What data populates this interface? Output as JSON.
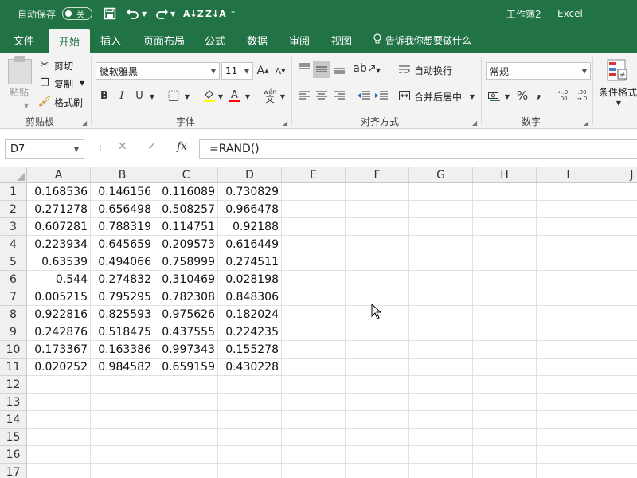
{
  "titlebar": {
    "autosave_label": "自动保存",
    "autosave_state": "关",
    "doc_title": "工作簿2",
    "separator": "-",
    "app_name": "Excel",
    "icons": [
      "save-icon",
      "undo-icon",
      "redo-icon",
      "sort-ascending-icon",
      "sort-descending-icon",
      "customize-quick-access-icon"
    ]
  },
  "tabs": [
    "文件",
    "开始",
    "插入",
    "页面布局",
    "公式",
    "数据",
    "审阅",
    "视图"
  ],
  "active_tab": "开始",
  "tell_me": "告诉我你想要做什么",
  "ribbon": {
    "clipboard": {
      "paste": "粘贴",
      "cut": "剪切",
      "copy": "复制",
      "format_painter": "格式刷",
      "group_label": "剪贴板"
    },
    "font": {
      "font_name": "微软雅黑",
      "font_size": "11",
      "bold": "B",
      "italic": "I",
      "underline": "U",
      "grow": "A",
      "shrink": "A",
      "phonetic_top": "wén",
      "phonetic_bottom": "文",
      "group_label": "字体",
      "fill_color": "#ffff00",
      "font_color": "#ff0000"
    },
    "alignment": {
      "wrap_text": "自动换行",
      "merge_center": "合并后居中",
      "group_label": "对齐方式"
    },
    "number": {
      "format": "常规",
      "percent": "%",
      "comma": ",",
      "group_label": "数字"
    },
    "styles": {
      "conditional_formatting": "条件格式"
    }
  },
  "formula_bar": {
    "name_box": "D7",
    "cancel": "✕",
    "enter": "✓",
    "function": "fx",
    "formula": "=RAND()"
  },
  "sheet": {
    "columns": [
      "A",
      "B",
      "C",
      "D",
      "E",
      "F",
      "G",
      "H",
      "I",
      "J"
    ],
    "row_numbers": [
      "1",
      "2",
      "3",
      "4",
      "5",
      "6",
      "7",
      "8",
      "9",
      "10",
      "11",
      "12",
      "13",
      "14",
      "15",
      "16",
      "17"
    ],
    "rows": [
      [
        "0.168536",
        "0.146156",
        "0.116089",
        "0.730829"
      ],
      [
        "0.271278",
        "0.656498",
        "0.508257",
        "0.966478"
      ],
      [
        "0.607281",
        "0.788319",
        "0.114751",
        "0.92188"
      ],
      [
        "0.223934",
        "0.645659",
        "0.209573",
        "0.616449"
      ],
      [
        "0.63539",
        "0.494066",
        "0.758999",
        "0.274511"
      ],
      [
        "0.544",
        "0.274832",
        "0.310469",
        "0.028198"
      ],
      [
        "0.005215",
        "0.795295",
        "0.782308",
        "0.848306"
      ],
      [
        "0.922816",
        "0.825593",
        "0.975626",
        "0.182024"
      ],
      [
        "0.242876",
        "0.518475",
        "0.437555",
        "0.224235"
      ],
      [
        "0.173367",
        "0.163386",
        "0.997343",
        "0.155278"
      ],
      [
        "0.020252",
        "0.984582",
        "0.659159",
        "0.430228"
      ]
    ]
  },
  "colors": {
    "brand": "#217346",
    "ribbon_bg": "#f3f3f3"
  }
}
